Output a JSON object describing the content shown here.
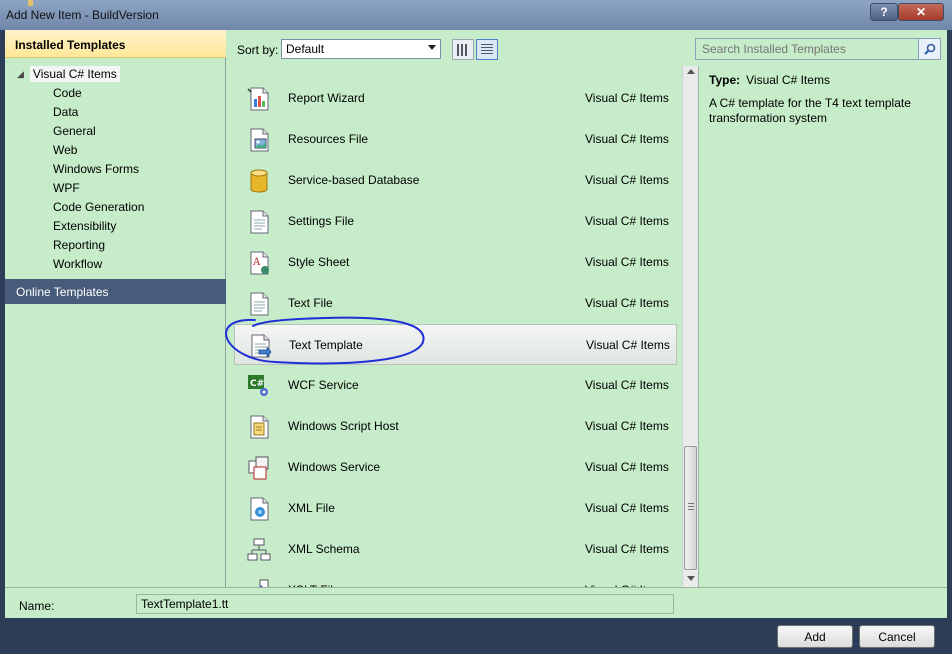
{
  "window": {
    "title": "Add New Item - BuildVersion",
    "help_label": "?",
    "close_label": "✕"
  },
  "left": {
    "installed_header": "Installed Templates",
    "root": "Visual C# Items",
    "children": [
      "Code",
      "Data",
      "General",
      "Web",
      "Windows Forms",
      "WPF",
      "Code Generation",
      "Extensibility",
      "Reporting",
      "Workflow"
    ],
    "online_header": "Online Templates"
  },
  "toolbar": {
    "sort_label": "Sort by:",
    "sort_value": "Default"
  },
  "search": {
    "placeholder": "Search Installed Templates"
  },
  "templates": [
    {
      "name": "Report Wizard",
      "category": "Visual C# Items",
      "icon": "report-wizard-icon"
    },
    {
      "name": "Resources File",
      "category": "Visual C# Items",
      "icon": "resources-file-icon"
    },
    {
      "name": "Service-based Database",
      "category": "Visual C# Items",
      "icon": "database-icon"
    },
    {
      "name": "Settings File",
      "category": "Visual C# Items",
      "icon": "settings-file-icon"
    },
    {
      "name": "Style Sheet",
      "category": "Visual C# Items",
      "icon": "style-sheet-icon"
    },
    {
      "name": "Text File",
      "category": "Visual C# Items",
      "icon": "text-file-icon"
    },
    {
      "name": "Text Template",
      "category": "Visual C# Items",
      "icon": "text-template-icon",
      "selected": true
    },
    {
      "name": "WCF Service",
      "category": "Visual C# Items",
      "icon": "wcf-service-icon"
    },
    {
      "name": "Windows Script Host",
      "category": "Visual C# Items",
      "icon": "script-host-icon"
    },
    {
      "name": "Windows Service",
      "category": "Visual C# Items",
      "icon": "windows-service-icon"
    },
    {
      "name": "XML File",
      "category": "Visual C# Items",
      "icon": "xml-file-icon"
    },
    {
      "name": "XML Schema",
      "category": "Visual C# Items",
      "icon": "xml-schema-icon"
    },
    {
      "name": "XSLT File",
      "category": "Visual C# Items",
      "icon": "xslt-file-icon"
    }
  ],
  "details": {
    "type_label": "Type:",
    "type_value": "Visual C# Items",
    "description": "A C# template for the T4 text template transformation system"
  },
  "name_field": {
    "label": "Name:",
    "value": "TextTemplate1.tt"
  },
  "buttons": {
    "add": "Add",
    "cancel": "Cancel"
  },
  "colors": {
    "pane_bg": "#c6ecc9",
    "frame": "#2d3c57",
    "annotation": "#1e2fd6"
  }
}
